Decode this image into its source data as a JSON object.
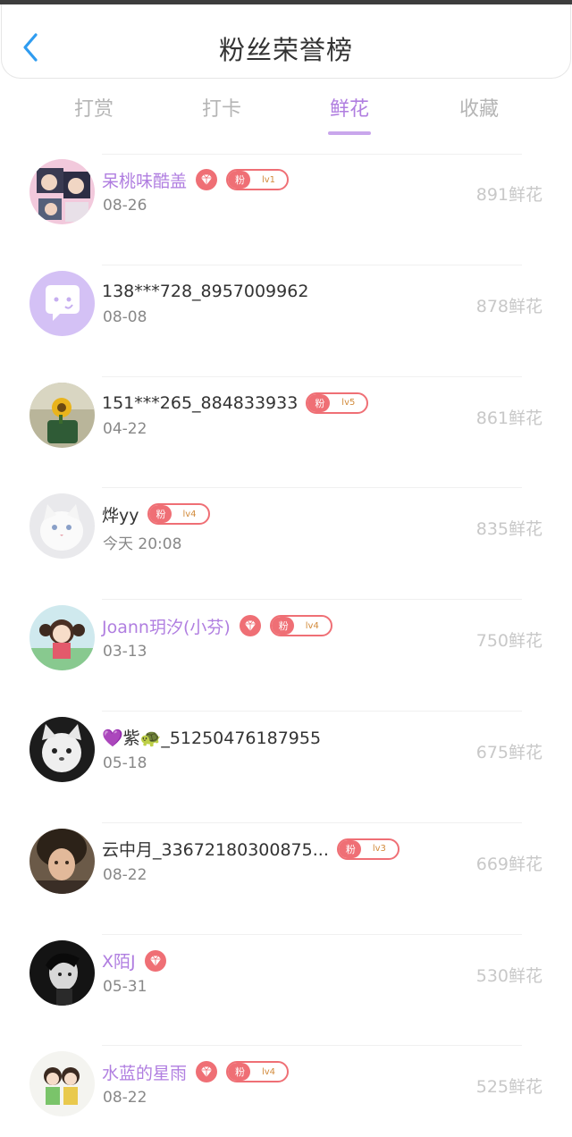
{
  "header": {
    "title": "粉丝荣誉榜",
    "back_icon": "chevron-left-icon"
  },
  "tabs": [
    {
      "label": "打赏",
      "active": false
    },
    {
      "label": "打卡",
      "active": false
    },
    {
      "label": "鲜花",
      "active": true
    },
    {
      "label": "收藏",
      "active": false
    }
  ],
  "colors": {
    "accent": "#b07ee0",
    "badge": "#ef6f75",
    "back": "#2f9cf0"
  },
  "rows": [
    {
      "name": "呆桃味酷盖",
      "vip": true,
      "gem": true,
      "badge": {
        "fan": "粉",
        "level": "lv1"
      },
      "date": "08-26",
      "amount": "891鲜花"
    },
    {
      "name": "138***728_8957009962",
      "vip": false,
      "gem": false,
      "badge": null,
      "date": "08-08",
      "amount": "878鲜花"
    },
    {
      "name": "151***265_884833933",
      "vip": false,
      "gem": false,
      "badge": {
        "fan": "粉",
        "level": "lv5"
      },
      "date": "04-22",
      "amount": "861鲜花"
    },
    {
      "name": "烨yy",
      "vip": false,
      "gem": false,
      "badge": {
        "fan": "粉",
        "level": "lv4"
      },
      "date": "今天 20:08",
      "amount": "835鲜花"
    },
    {
      "name": "Joann玥汐(小芬)",
      "vip": true,
      "gem": true,
      "badge": {
        "fan": "粉",
        "level": "lv4"
      },
      "date": "03-13",
      "amount": "750鲜花"
    },
    {
      "name": "💜紫🐢_51250476187955",
      "vip": false,
      "gem": false,
      "badge": null,
      "date": "05-18",
      "amount": "675鲜花"
    },
    {
      "name": "云中月_33672180300875...",
      "vip": false,
      "gem": false,
      "badge": {
        "fan": "粉",
        "level": "lv3"
      },
      "date": "08-22",
      "amount": "669鲜花"
    },
    {
      "name": "X陌J",
      "vip": true,
      "gem": true,
      "badge": null,
      "date": "05-31",
      "amount": "530鲜花"
    },
    {
      "name": "水蓝的星雨",
      "vip": true,
      "gem": true,
      "badge": {
        "fan": "粉",
        "level": "lv4"
      },
      "date": "08-22",
      "amount": "525鲜花"
    }
  ]
}
